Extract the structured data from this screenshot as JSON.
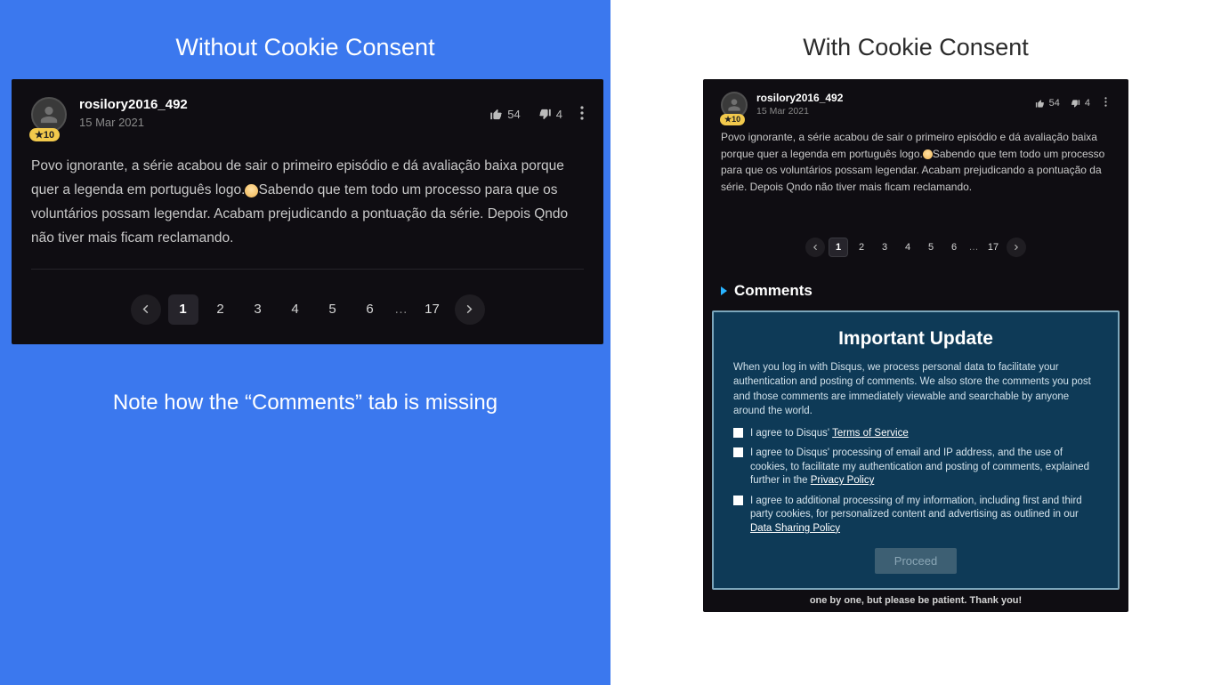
{
  "left": {
    "title": "Without Cookie Consent",
    "comment": {
      "username": "rosilory2016_492",
      "badge": "★10",
      "date": "15 Mar 2021",
      "likes": "54",
      "dislikes": "4",
      "body_a": "Povo ignorante, a série acabou de sair o primeiro episódio e dá avaliação baixa porque quer a legenda em português logo.",
      "body_b": "Sabendo que tem todo um processo para que os voluntários possam legendar. Acabam prejudicando a pontuação da série. Depois Qndo não tiver mais ficam reclamando."
    },
    "pages": [
      "1",
      "2",
      "3",
      "4",
      "5",
      "6",
      "…",
      "17"
    ],
    "note": "Note how the “Comments” tab is missing"
  },
  "right": {
    "title": "With Cookie Consent",
    "comment": {
      "username": "rosilory2016_492",
      "badge": "★10",
      "date": "15 Mar 2021",
      "likes": "54",
      "dislikes": "4",
      "body_a": "Povo ignorante, a série acabou de sair o primeiro episódio e dá avaliação baixa porque quer a legenda em português logo.",
      "body_b": "Sabendo que tem todo um processo para que os voluntários possam legendar. Acabam prejudicando a pontuação da série. Depois Qndo não tiver mais ficam reclamando."
    },
    "pages": [
      "1",
      "2",
      "3",
      "4",
      "5",
      "6",
      "…",
      "17"
    ],
    "comments_label": "Comments",
    "consent": {
      "heading": "Important Update",
      "intro": "When you log in with Disqus, we process personal data to facilitate your authentication and posting of comments. We also store the comments you post and those comments are immediately viewable and searchable by anyone around the world.",
      "item1_pre": "I agree to Disqus' ",
      "item1_link": "Terms of Service",
      "item2_pre": "I agree to Disqus' processing of email and IP address, and the use of cookies, to facilitate my authentication and posting of comments, explained further in the ",
      "item2_link": "Privacy Policy",
      "item3_pre": "I agree to additional processing of my information, including first and third party cookies, for personalized content and advertising as outlined in our ",
      "item3_link": "Data Sharing Policy",
      "proceed": "Proceed"
    },
    "footer_strip": "one by one, but please be patient. Thank you!"
  }
}
